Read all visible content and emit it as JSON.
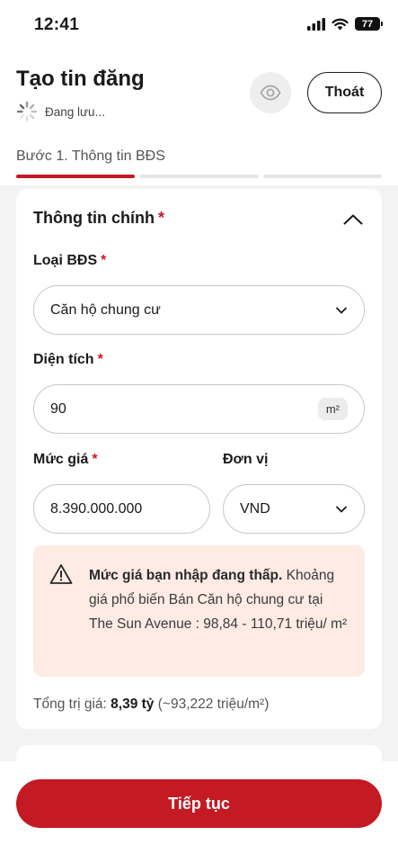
{
  "status_bar": {
    "time": "12:41",
    "battery": "77"
  },
  "header": {
    "title": "Tạo tin đăng",
    "saving_text": "Đang lưu...",
    "exit_label": "Thoát"
  },
  "step": {
    "label": "Bước 1. Thông tin BĐS",
    "progress_fraction": 0.33
  },
  "main_info": {
    "section_title": "Thông tin chính",
    "required_mark": "*",
    "property_type": {
      "label": "Loại BĐS",
      "value": "Căn hộ chung cư"
    },
    "area": {
      "label": "Diện tích",
      "value": "90",
      "unit": "m²"
    },
    "price": {
      "label": "Mức giá",
      "value": "8.390.000.000"
    },
    "currency": {
      "label": "Đơn vị",
      "value": "VND"
    },
    "warning": {
      "strong": "Mức giá bạn nhập đang thấp.",
      "text": " Khoảng giá phổ biến Bán Căn hộ chung cư tại The Sun Avenue : 98,84 - 110,71 triệu/ m²"
    },
    "total": {
      "prefix": "Tổng trị giá:",
      "value": "8,39 tỷ",
      "per_unit": "(~93,222 triệu/m²)"
    }
  },
  "footer": {
    "continue_label": "Tiếp tục"
  },
  "colors": {
    "accent": "#c41a23",
    "warning_bg": "#fdebe4"
  }
}
